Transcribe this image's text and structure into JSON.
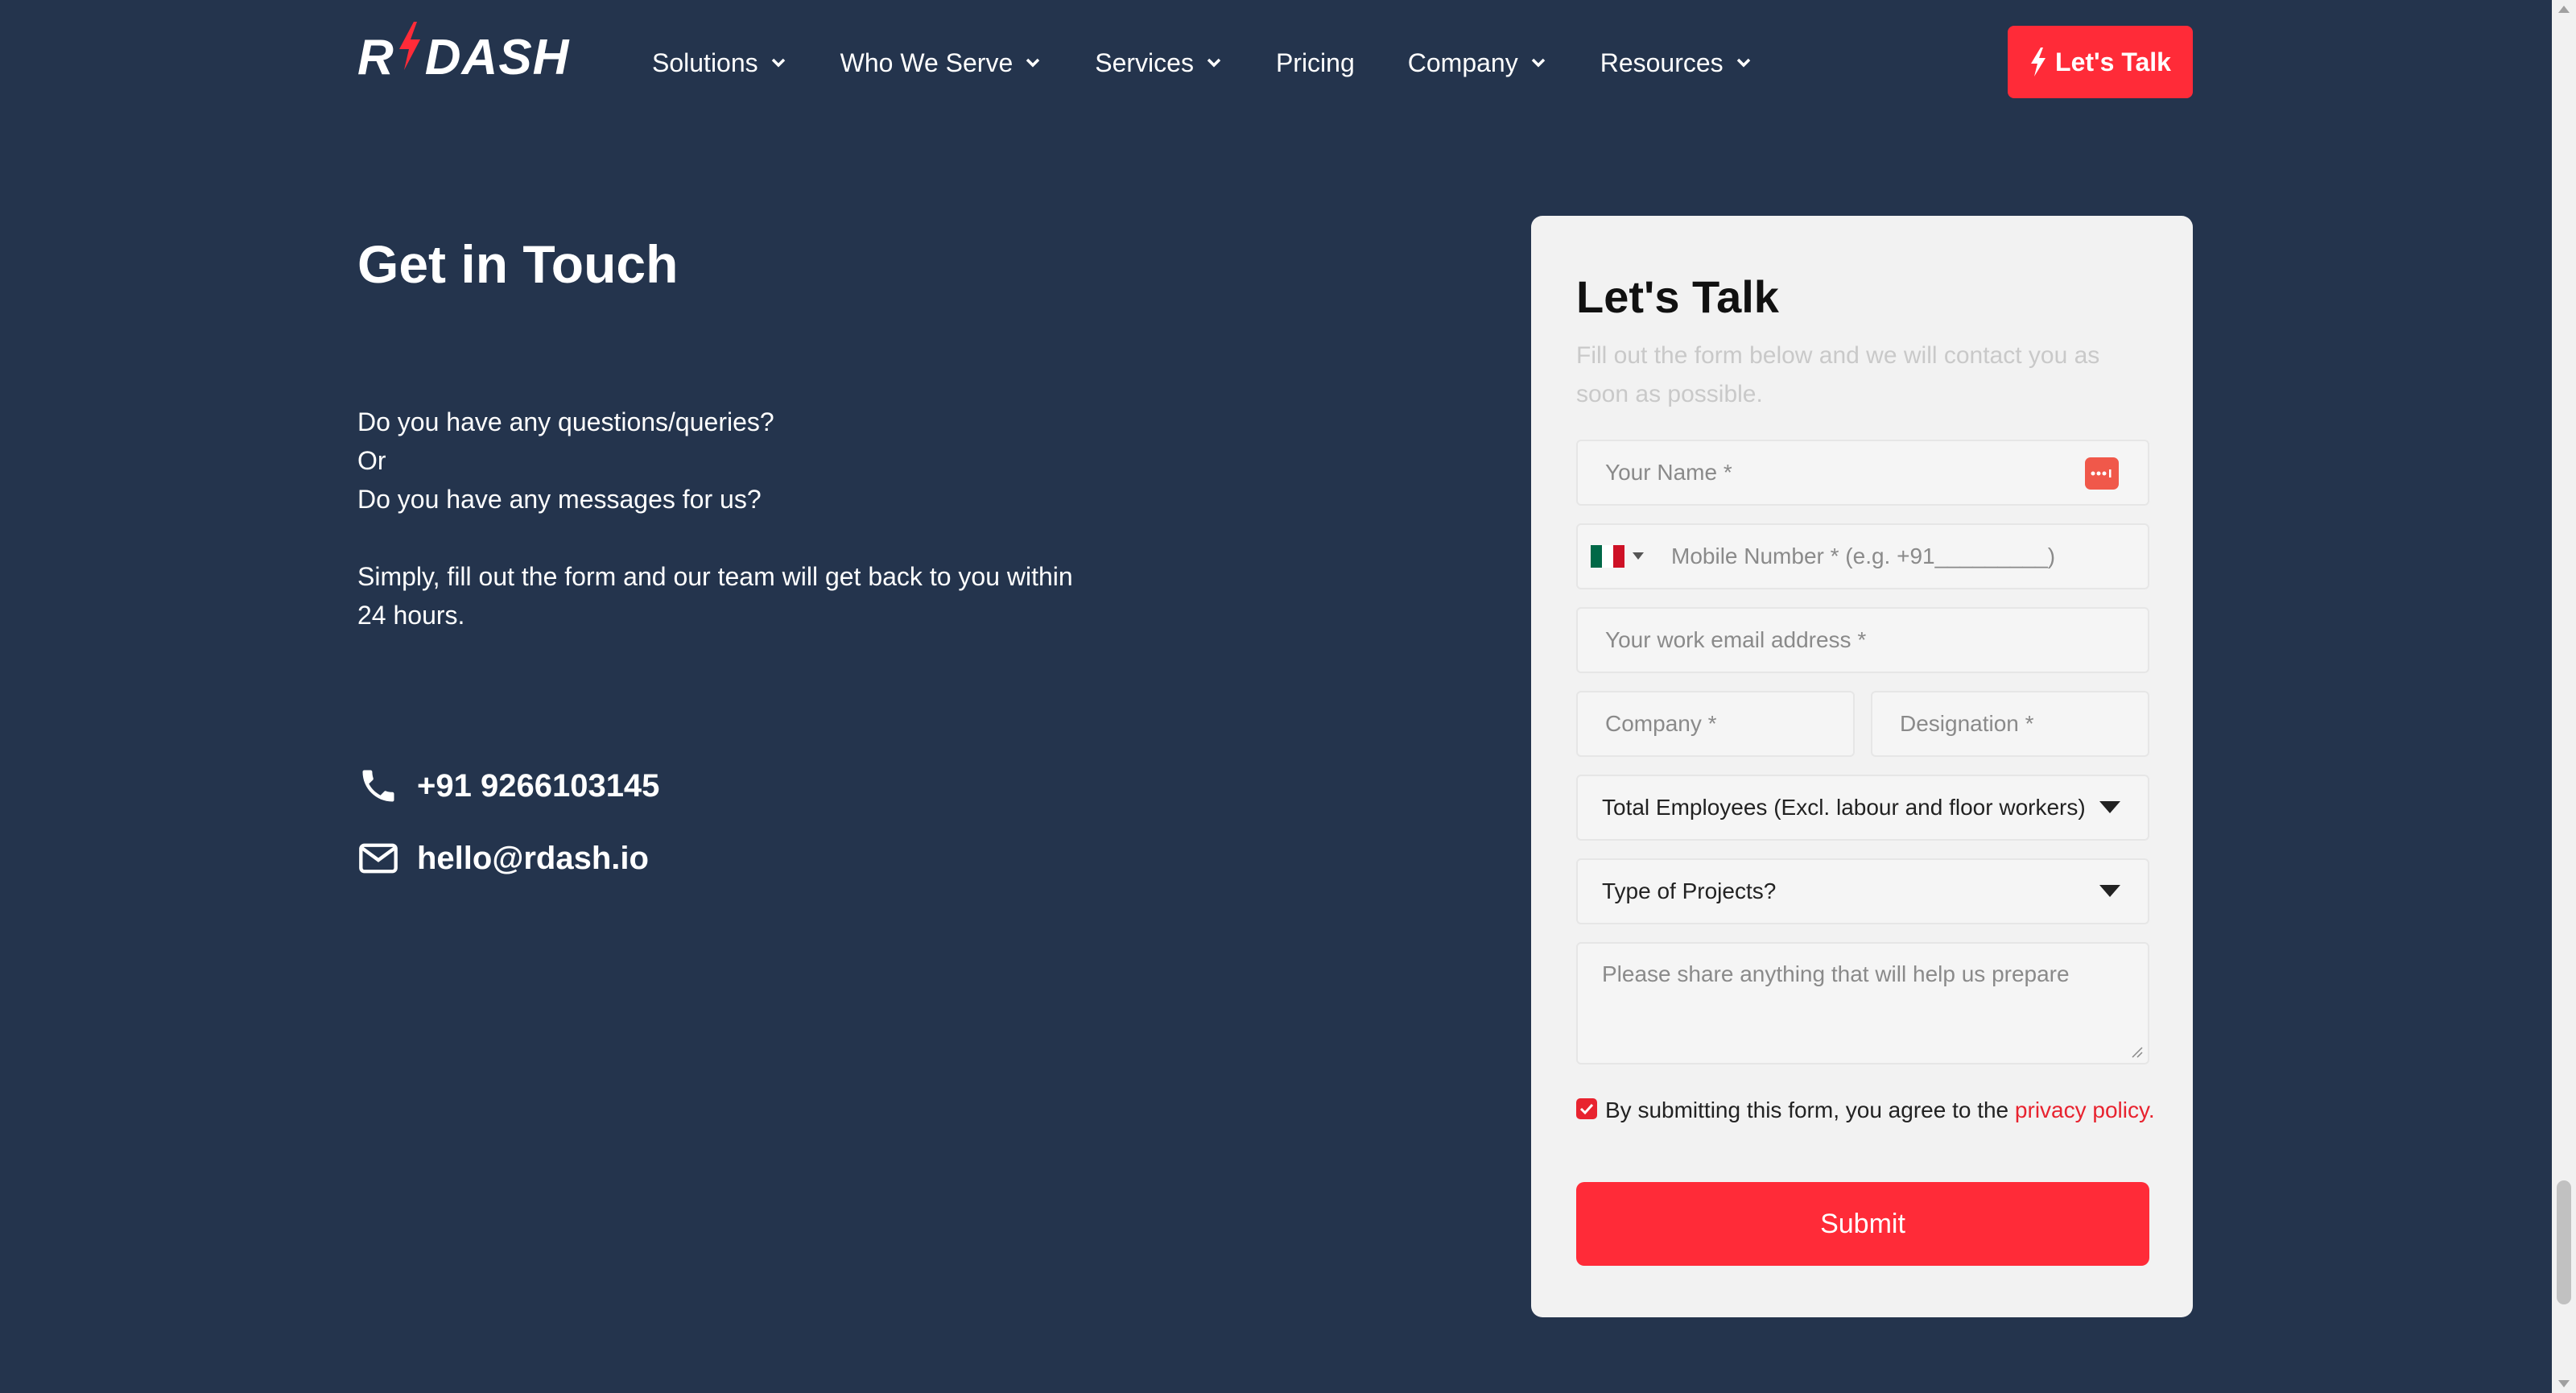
{
  "header": {
    "logo_left": "R",
    "logo_right": "DASH",
    "nav": [
      {
        "label": "Solutions",
        "has_dropdown": true
      },
      {
        "label": "Who We Serve",
        "has_dropdown": true
      },
      {
        "label": "Services",
        "has_dropdown": true
      },
      {
        "label": "Pricing",
        "has_dropdown": false
      },
      {
        "label": "Company",
        "has_dropdown": true
      },
      {
        "label": "Resources",
        "has_dropdown": true
      }
    ],
    "cta_label": "Let's Talk"
  },
  "left": {
    "heading": "Get in Touch",
    "intro_lines": [
      "Do you have any questions/queries?",
      "Or",
      "Do you have any messages for us?"
    ],
    "intro_para": "Simply, fill out the form and our team will get back to you within 24 hours.",
    "phone": "+91 9266103145",
    "email": "hello@rdash.io"
  },
  "form": {
    "title": "Let's Talk",
    "subtitle": "Fill out the form below and we will contact you as soon as possible.",
    "name_placeholder": "Your Name *",
    "phone_placeholder": "Mobile Number * (e.g. +91_________)",
    "email_placeholder": "Your work email address *",
    "company_placeholder": "Company *",
    "designation_placeholder": "Designation *",
    "employees_select": "Total Employees (Excl. labour and floor workers)",
    "projects_select": "Type of Projects?",
    "message_placeholder": "Please share anything that will help us prepare",
    "consent_text": "By submitting this form, you agree to the ",
    "consent_link": "privacy policy.",
    "consent_checked": true,
    "submit_label": "Submit"
  },
  "colors": {
    "background": "#24344d",
    "accent": "#ff2b38",
    "card": "#f2f2f2"
  },
  "icons": {
    "logo": "bolt-icon",
    "nav_dropdown": "chevron-down-icon",
    "cta": "bolt-icon",
    "phone": "phone-icon",
    "email": "mail-icon",
    "autofill": "password-dots-icon",
    "country": "mexico-flag-icon",
    "select": "caret-down-icon"
  }
}
